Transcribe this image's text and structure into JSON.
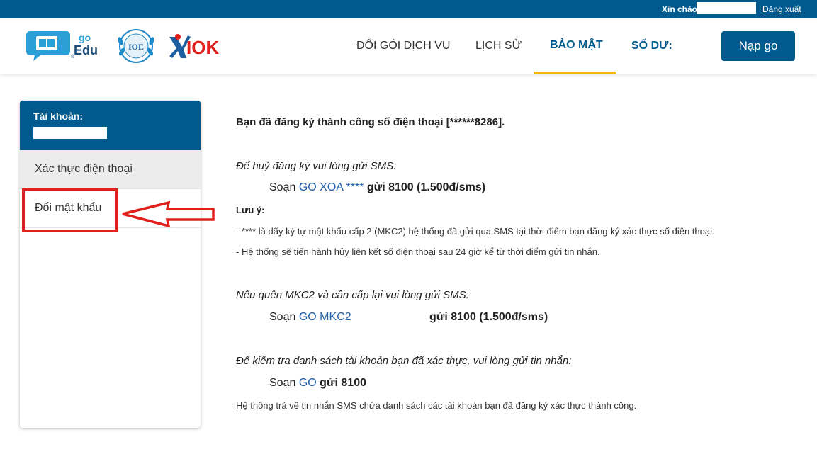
{
  "topbar": {
    "greeting": "Xin chào:",
    "logout": "Đăng xuất"
  },
  "logos": {
    "goedu_go": "go",
    "goedu_edu": "Edu",
    "ioe": "IOE",
    "iok": "IOK"
  },
  "nav": {
    "items": [
      {
        "label": "ĐỔI GÓI DỊCH VỤ"
      },
      {
        "label": "LỊCH SỬ"
      },
      {
        "label": "BẢO MẬT"
      },
      {
        "label": "SỐ DƯ:"
      }
    ],
    "topup_label": "Nạp go"
  },
  "sidebar": {
    "header_label": "Tài khoản:",
    "items": [
      {
        "label": "Xác thực điện thoại"
      },
      {
        "label": "Đổi mật khẩu"
      }
    ]
  },
  "content": {
    "success": "Bạn đã đăng ký thành công số điện thoại [******8286].",
    "cancel_title": "Để huỷ đăng ký vui lòng gửi SMS:",
    "cancel_cmd": {
      "prefix": "Soạn ",
      "keyword": "GO XOA ****",
      "suffix": " gửi 8100 (1.500đ/sms)"
    },
    "note_title": "Lưu ý:",
    "note_1": "- **** là dãy ký tự mật khẩu cấp 2 (MKC2) hệ thống đã gửi qua SMS tại thời điểm bạn đăng ký xác thực số điện thoại.",
    "note_2": "- Hệ thống sẽ tiến hành hủy liên kết số điện thoại sau 24 giờ kể từ thời điểm gửi tin nhắn.",
    "mkc2_title": "Nếu quên MKC2 và cần cấp lại vui lòng gửi SMS:",
    "mkc2_cmd": {
      "prefix": "Soạn ",
      "keyword": "GO MKC2",
      "suffix": "gửi 8100 (1.500đ/sms)"
    },
    "check_title": "Để kiểm tra danh sách tài khoản bạn đã xác thực, vui lòng gửi tin nhắn:",
    "check_cmd": {
      "prefix": "Soạn ",
      "keyword": "GO",
      "suffix": " gửi 8100"
    },
    "check_desc": "Hệ thống trả về tin nhắn SMS chứa danh sách các tài khoản bạn đã đăng ký xác thực thành công."
  },
  "colors": {
    "brand_blue": "#005a8e",
    "accent_yellow": "#f5b800",
    "highlight_red": "#e0201c",
    "keyword_blue": "#1f5ea8"
  }
}
